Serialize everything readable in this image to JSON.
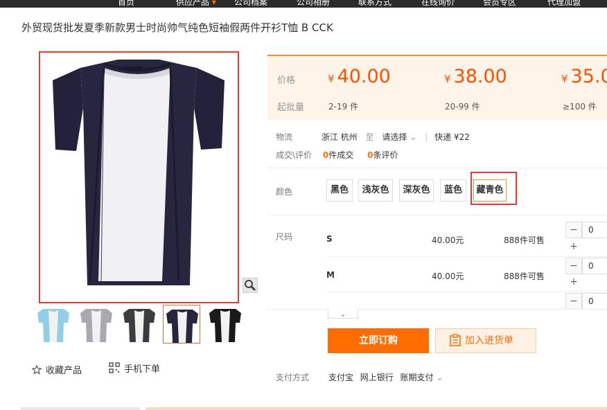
{
  "nav": {
    "items": [
      "首页",
      "供应产品",
      "公司档案",
      "公司相册",
      "联系方式",
      "在线询价",
      "会员专区",
      "代理加盟"
    ],
    "active_index": 1
  },
  "product": {
    "title": "外贸现货批发夏季新款男士时尚帅气纯色短袖假两件开衫T恤 B CCK"
  },
  "actions": {
    "favorite": "收藏产品",
    "mobile_order": "手机下单"
  },
  "pricing": {
    "price_label": "价格",
    "moq_label": "起批量",
    "currency": "¥",
    "tiers": [
      {
        "price": "40.00",
        "qty": "2-19 件"
      },
      {
        "price": "38.00",
        "qty": "20-99 件"
      },
      {
        "price": "35.0",
        "qty": "≥100 件"
      }
    ]
  },
  "logistics": {
    "label": "物流",
    "origin": "浙江 杭州",
    "to": "至",
    "destination": "请选择",
    "delivery": "快递 ¥22"
  },
  "stats": {
    "label": "成交\\评价",
    "deals_count": "0",
    "deals_text": "件成交",
    "reviews_count": "0",
    "reviews_text": "条评价"
  },
  "colors": {
    "label": "颜色",
    "options": [
      "黑色",
      "浅灰色",
      "深灰色",
      "蓝色",
      "藏青色"
    ],
    "selected_index": 4
  },
  "sizes": {
    "label": "尺码",
    "rows": [
      {
        "name": "S",
        "price": "40.00元",
        "stock": "888件可售",
        "qty": "0"
      },
      {
        "name": "M",
        "price": "40.00元",
        "stock": "888件可售",
        "qty": "0"
      },
      {
        "name": "",
        "price": "",
        "stock": "",
        "qty": "0"
      }
    ]
  },
  "buttons": {
    "buy_now": "立即订购",
    "add_to_list": "加入进货单"
  },
  "payment": {
    "label": "支付方式",
    "methods": [
      "支付宝",
      "网上银行",
      "账期支付"
    ]
  },
  "colors_theme": {
    "accent": "#ff6d00",
    "highlight": "#e53935",
    "price": "#ff5000"
  }
}
